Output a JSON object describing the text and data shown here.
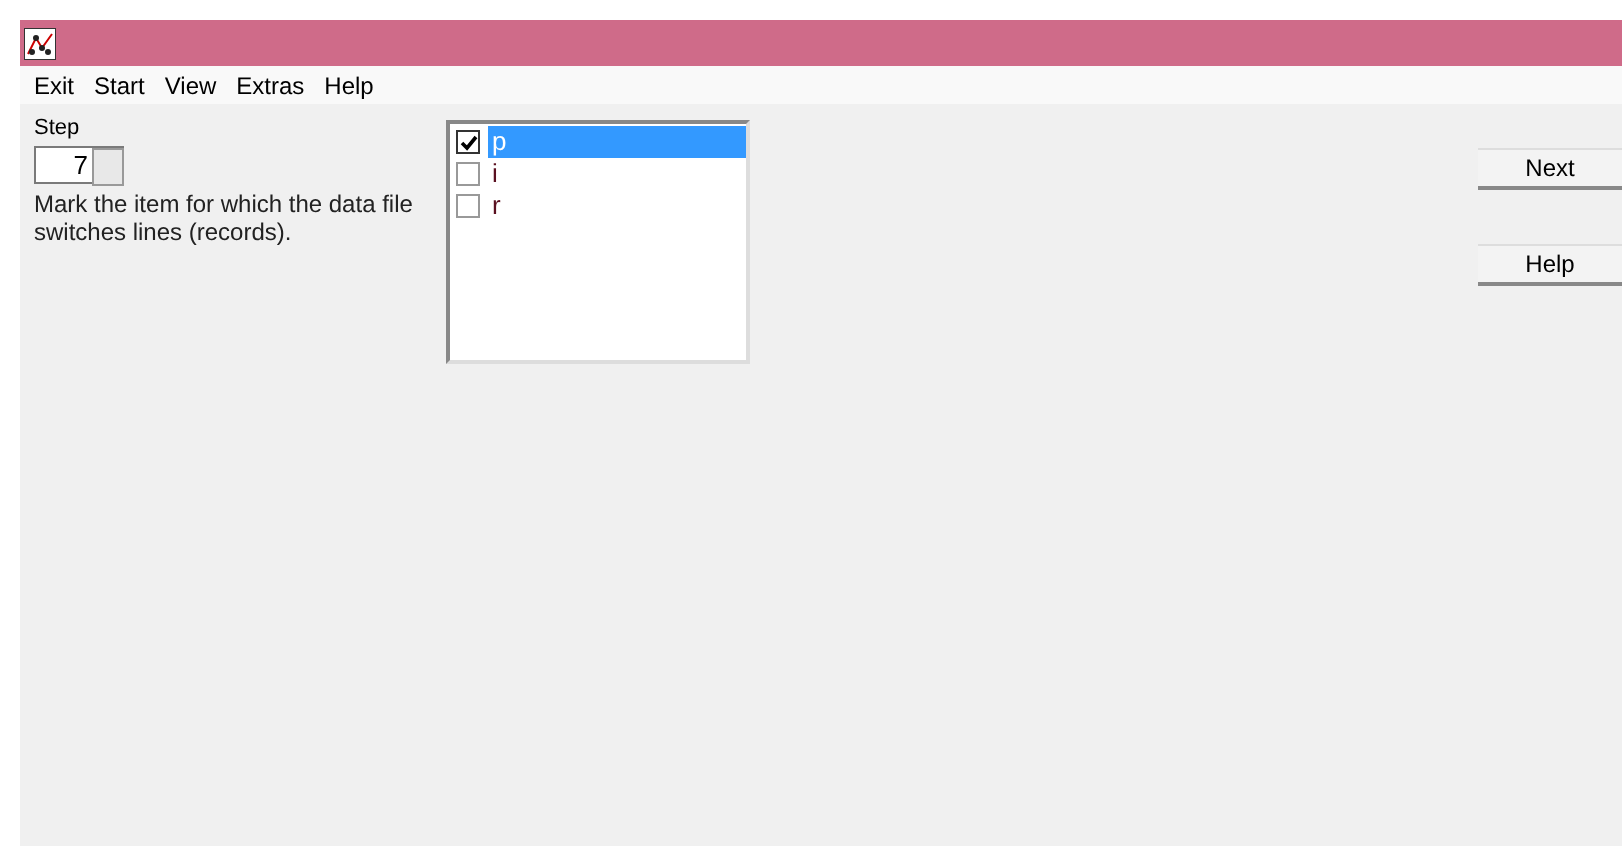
{
  "menu": [
    "Exit",
    "Start",
    "View",
    "Extras",
    "Help"
  ],
  "step": {
    "label": "Step",
    "value": "7"
  },
  "instruction": "Mark the item for which the data file switches lines (records).",
  "items": [
    {
      "label": "p",
      "checked": true,
      "selected": true
    },
    {
      "label": "i",
      "checked": false,
      "selected": false
    },
    {
      "label": "r",
      "checked": false,
      "selected": false
    }
  ],
  "buttons": [
    "Next",
    "Help"
  ]
}
